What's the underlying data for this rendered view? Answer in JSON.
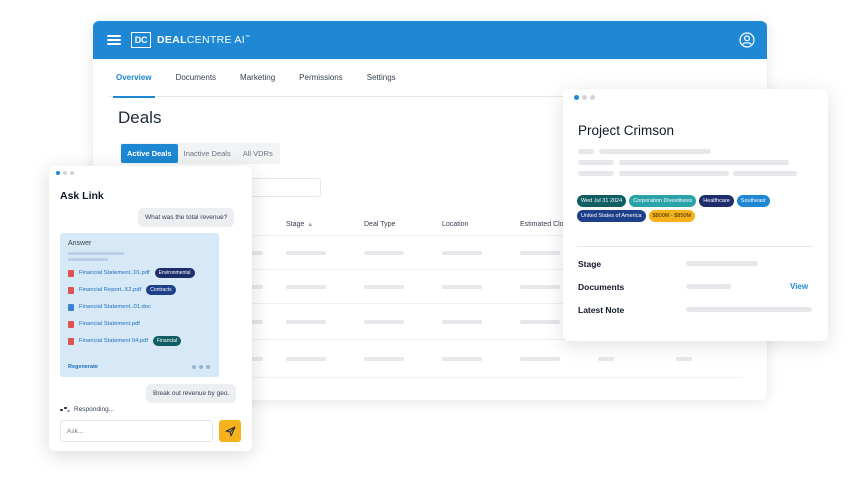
{
  "app": {
    "logo_mark": "DC",
    "brand_prefix": "DEAL",
    "brand_suffix": "CENTRE AI",
    "brand_tm": "™",
    "colors": {
      "brand": "#1e88d4",
      "accent": "#f5b21c"
    }
  },
  "nav": {
    "tabs": [
      {
        "label": "Overview",
        "active": true
      },
      {
        "label": "Documents",
        "active": false
      },
      {
        "label": "Marketing",
        "active": false
      },
      {
        "label": "Permissions",
        "active": false
      },
      {
        "label": "Settings",
        "active": false
      }
    ]
  },
  "deals": {
    "title": "Deals",
    "filters": [
      {
        "label": "Active Deals",
        "active": true
      },
      {
        "label": "Inactive Deals",
        "active": false
      },
      {
        "label": "All VDRs",
        "active": false
      }
    ],
    "columns": {
      "stage": "Stage",
      "deal_type": "Deal Type",
      "location": "Location",
      "estimated_close": "Estimated Clo"
    }
  },
  "project": {
    "title": "Project Crimson",
    "tags": [
      {
        "label": "Wed Jul 31 2024",
        "color": "#0f5e63"
      },
      {
        "label": "Corporation Divestitures",
        "color": "#2aa3a8"
      },
      {
        "label": "Healthcare",
        "color": "#1e2d6b"
      },
      {
        "label": "Southeast",
        "color": "#1e88d4"
      },
      {
        "label": "United States of America",
        "color": "#1e3f8a"
      },
      {
        "label": "$800M - $850M",
        "color": "#f5b21c"
      }
    ],
    "fields": {
      "stage": "Stage",
      "documents": "Documents",
      "documents_link": "View",
      "latest_note": "Latest Note"
    }
  },
  "ask": {
    "title": "Ask Link",
    "question_1": "What was the total revenue?",
    "answer_label": "Answer",
    "files": [
      {
        "name": "Financial Statement..01.pdf",
        "type": "pdf",
        "tag": "Environmental",
        "tag_color": "#1e2d6b"
      },
      {
        "name": "Financial Report..X2.pdf",
        "type": "pdf",
        "tag": "Contracts",
        "tag_color": "#1e3f8a"
      },
      {
        "name": "Financial Statement..01.doc",
        "type": "doc",
        "tag": "",
        "tag_color": ""
      },
      {
        "name": "Financial Statement.pdf",
        "type": "pdf",
        "tag": "",
        "tag_color": ""
      },
      {
        "name": "Financial Statement 04.pdf",
        "type": "pdf",
        "tag": "Financial",
        "tag_color": "#0f5e63"
      }
    ],
    "regenerate": "Regenerate",
    "question_2": "Break out revenue by geo.",
    "status": "Responding...",
    "input_placeholder": "Ask..."
  }
}
